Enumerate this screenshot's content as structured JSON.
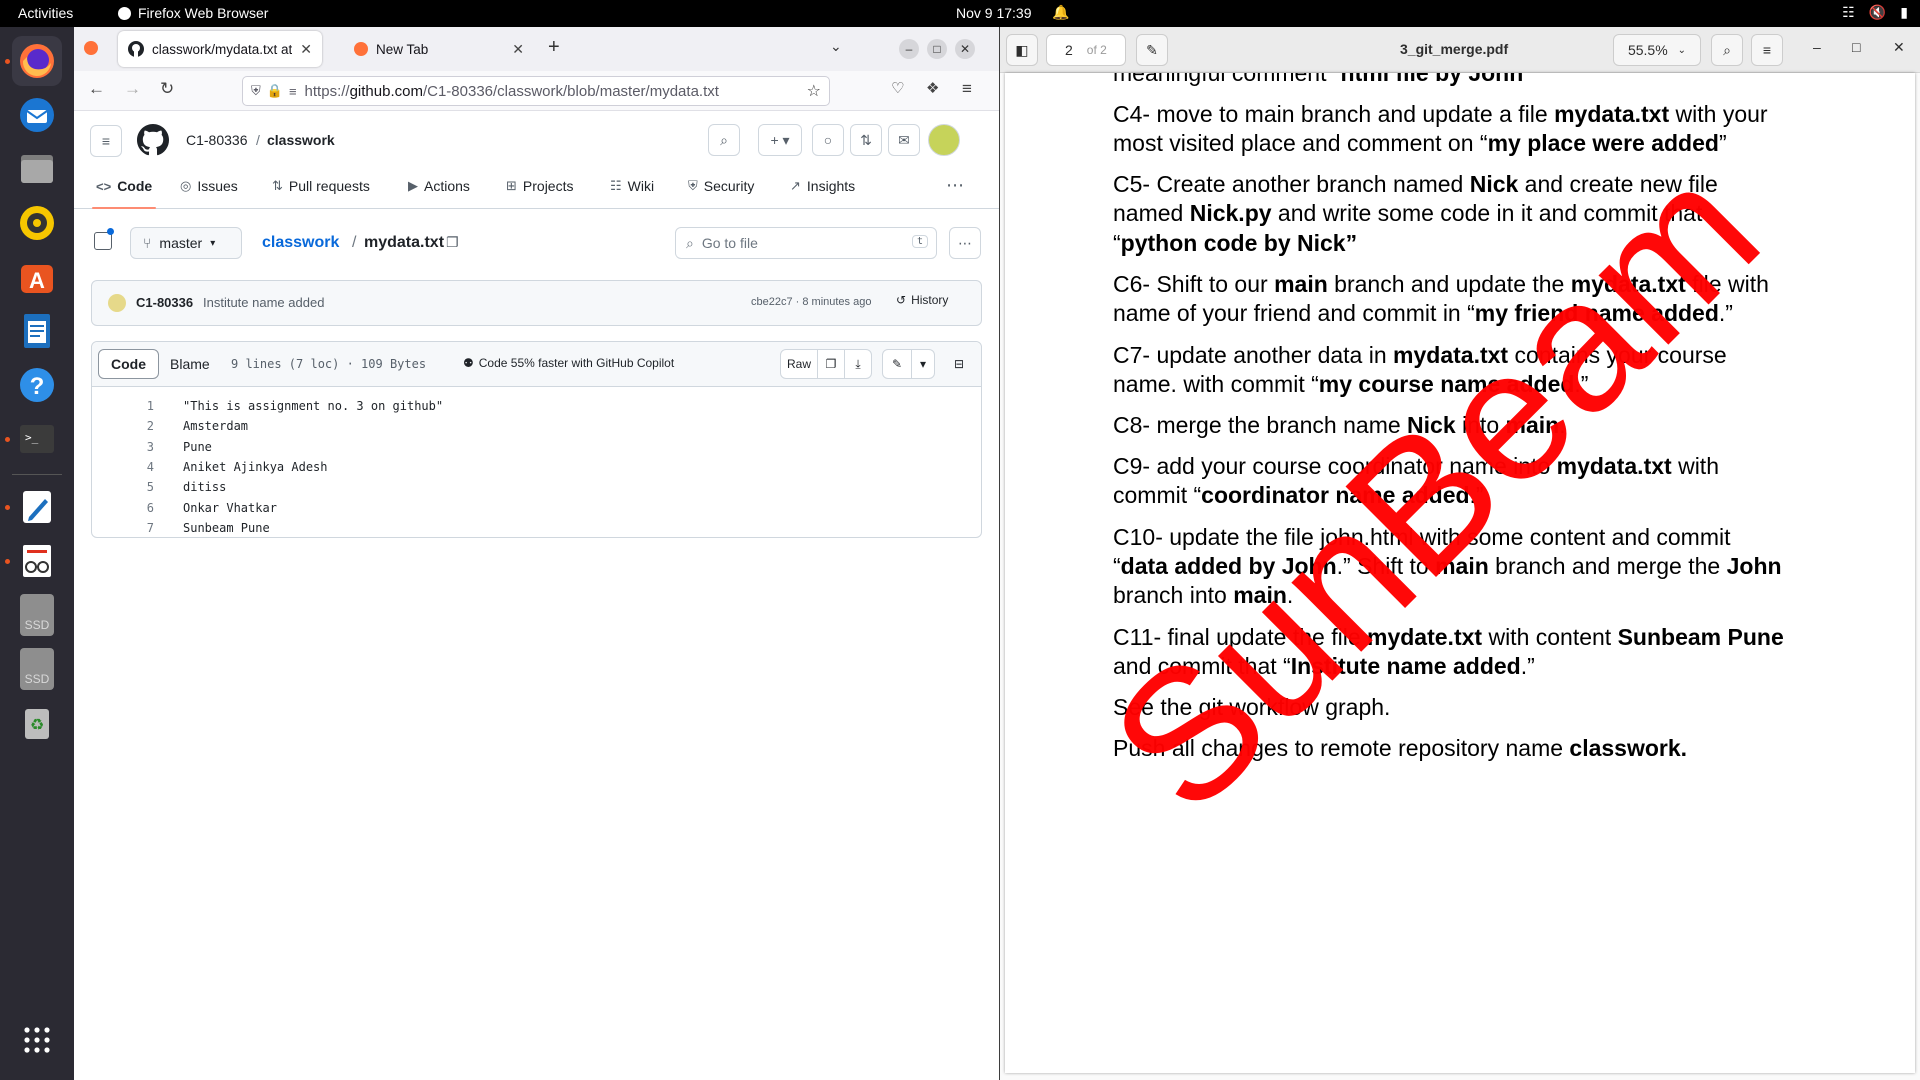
{
  "topbar": {
    "activities": "Activities",
    "app_name": "Firefox Web Browser",
    "clock": "Nov 9  17:39"
  },
  "dock": {
    "items": [
      "firefox-icon",
      "thunderbird-icon",
      "files-icon",
      "rhythmbox-icon",
      "app-center-icon",
      "writer-icon",
      "help-icon",
      "terminal-icon",
      "text-editor-icon",
      "document-viewer-icon",
      "ssd-drive-icon",
      "ssd-drive-icon",
      "trash-icon",
      "app-grid-icon"
    ],
    "ssd_label": "SSD"
  },
  "browser": {
    "tabs": [
      {
        "label": "classwork/mydata.txt at"
      },
      {
        "label": "New Tab"
      }
    ],
    "url_prefix": "https://",
    "url_domain": "github.com",
    "url_path": "/C1-80336/classwork/blob/master/mydata.txt"
  },
  "github": {
    "owner": "C1-80336",
    "repo": "classwork",
    "nav": [
      "Code",
      "Issues",
      "Pull requests",
      "Actions",
      "Projects",
      "Wiki",
      "Security",
      "Insights"
    ],
    "branch": "master",
    "breadcrumb_repo": "classwork",
    "breadcrumb_file": "mydata.txt",
    "goto_placeholder": "Go to file",
    "goto_key": "t",
    "commit": {
      "author": "C1-80336",
      "message": "Institute name added",
      "meta": "cbe22c7 · 8 minutes ago",
      "history": "History"
    },
    "code_tab": "Code",
    "blame_tab": "Blame",
    "file_info": "9 lines (7 loc) · 109 Bytes",
    "copilot": "Code 55% faster with GitHub Copilot",
    "raw": "Raw",
    "lines": [
      {
        "n": "1",
        "text": "\"This is assignment no. 3 on github\""
      },
      {
        "n": "2",
        "text": "Amsterdam"
      },
      {
        "n": "3",
        "text": "Pune"
      },
      {
        "n": "4",
        "text": "Aniket Ajinkya Adesh"
      },
      {
        "n": "5",
        "text": "ditiss"
      },
      {
        "n": "6",
        "text": "Onkar Vhatkar"
      },
      {
        "n": "7",
        "text": "Sunbeam Pune"
      }
    ]
  },
  "pdf": {
    "page_current": "2",
    "page_total": "of 2",
    "title": "3_git_merge.pdf",
    "zoom": "55.5%",
    "watermark": "SunBeam",
    "content": {
      "c3_tail_a": "meaningful comment “",
      "c3_tail_b": "html file by John",
      "c4_a": "C4- move to main branch and update a file ",
      "c4_b": "mydata.txt",
      "c4_c": " with your",
      "c4_d": "most visited place and comment on “",
      "c4_e": "my place were added",
      "c4_f": "”",
      "c5_a": "C5- Create another branch named ",
      "c5_b": "Nick",
      "c5_c": " and create new file",
      "c5_d": "named ",
      "c5_e": "Nick.py",
      "c5_f": " and write some code in it and commit that",
      "c5_g": "“",
      "c5_h": "python code by Nick”",
      "c6_a": "C6- Shift to our ",
      "c6_b": "main",
      "c6_c": " branch and update the ",
      "c6_d": "mydata.txt",
      "c6_e": " file with",
      "c6_f": "name of your friend and commit in “",
      "c6_g": "my friend name added",
      "c6_h": ".”",
      "c7_a": "C7- update another data in ",
      "c7_b": "mydata.txt",
      "c7_c": " contains your course",
      "c7_d": "name. with commit “",
      "c7_e": "my course name added",
      "c7_f": ".”",
      "c8_a": "C8- merge the branch name ",
      "c8_b": "Nick",
      "c8_c": " into ",
      "c8_d": "main",
      "c8_e": ".",
      "c9_a": "C9- add your course coordinator name into ",
      "c9_b": "mydata.txt",
      "c9_c": " with",
      "c9_d": "commit “",
      "c9_e": "coordinator name added",
      "c9_f": ".”",
      "c10_a": "C10-  update the file john.html with some content and commit",
      "c10_b": "“",
      "c10_c": "data added by John",
      "c10_d": ".” Shift to ",
      "c10_e": "main",
      "c10_f": " branch and merge the ",
      "c10_g": "John",
      "c10_h": "branch into ",
      "c10_i": "main",
      "c10_j": ".",
      "c11_a": "C11- final update the file ",
      "c11_b": "mydate.txt",
      "c11_c": " with content ",
      "c11_d": "Sunbeam Pune",
      "c11_e": "and commit that “",
      "c11_f": "Institute name added",
      "c11_g": ".”",
      "see": "See the git workflow graph.",
      "push_a": "Push all changes to remote repository name ",
      "push_b": "classwork."
    }
  },
  "colors": {
    "accent_link": "#0969da",
    "tab_underline": "#fd8c73",
    "watermark": "#ff0000"
  }
}
